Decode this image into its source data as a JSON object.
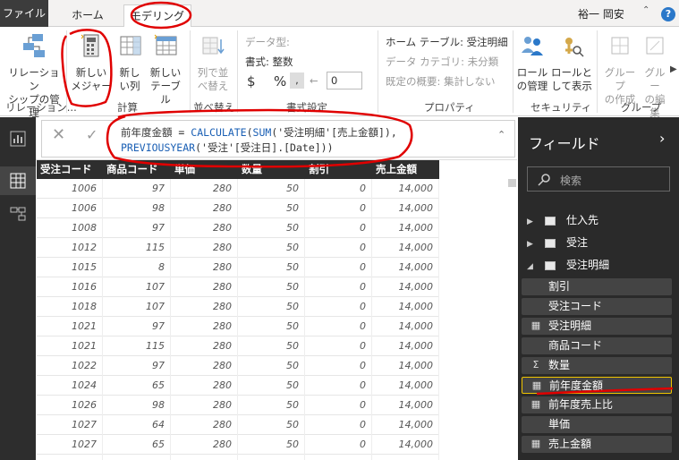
{
  "tabs": {
    "file": "ファイル",
    "home": "ホーム",
    "modeling": "モデリング"
  },
  "user": {
    "name": "裕一 岡安",
    "help": "?"
  },
  "ribbon": {
    "manage_relationships": "リレーション\nシップの管理",
    "new_measure": "新しい\nメジャー",
    "new_column": "新し\nい列",
    "new_table": "新しい\nテーブル",
    "sort_by_column": "列で並\nべ替え",
    "data_type": "データ型:",
    "format": "書式: 整数",
    "currency": "$",
    "percent": "%",
    "comma": ",",
    "decimals": "0",
    "home_table": "ホーム テーブル: 受注明細",
    "data_category": "データ カテゴリ: 未分類",
    "default_summary": "既定の概要: 集計しない",
    "manage_roles": "ロール\nの管理",
    "view_as_roles": "ロールと\nして表示",
    "new_group": "グループ\nの作成",
    "edit_groups": "グルー\nの編集",
    "groups": {
      "relationships": "リレーション...",
      "calculations": "計算",
      "sort": "並べ替え",
      "formatting": "書式設定",
      "properties": "プロパティ",
      "security": "セキュリティ",
      "group": "グループ"
    }
  },
  "formula": {
    "line1_prefix": "前年度金額 = ",
    "line1_fn1": "CALCULATE",
    "line1_paren": "(",
    "line1_fn2": "SUM",
    "line1_rest": "('受注明細'[売上金額]),",
    "line2_fn": "PREVIOUSYEAR",
    "line2_rest": "('受注'[受注日].[Date]))"
  },
  "table": {
    "columns": [
      "受注コード",
      "商品コード",
      "単価",
      "数量",
      "割引",
      "売上金額"
    ],
    "rows": [
      [
        "1006",
        "97",
        "280",
        "50",
        "0",
        "14,000"
      ],
      [
        "1006",
        "98",
        "280",
        "50",
        "0",
        "14,000"
      ],
      [
        "1008",
        "97",
        "280",
        "50",
        "0",
        "14,000"
      ],
      [
        "1012",
        "115",
        "280",
        "50",
        "0",
        "14,000"
      ],
      [
        "1015",
        "8",
        "280",
        "50",
        "0",
        "14,000"
      ],
      [
        "1016",
        "107",
        "280",
        "50",
        "0",
        "14,000"
      ],
      [
        "1018",
        "107",
        "280",
        "50",
        "0",
        "14,000"
      ],
      [
        "1021",
        "97",
        "280",
        "50",
        "0",
        "14,000"
      ],
      [
        "1021",
        "115",
        "280",
        "50",
        "0",
        "14,000"
      ],
      [
        "1022",
        "97",
        "280",
        "50",
        "0",
        "14,000"
      ],
      [
        "1024",
        "65",
        "280",
        "50",
        "0",
        "14,000"
      ],
      [
        "1026",
        "98",
        "280",
        "50",
        "0",
        "14,000"
      ],
      [
        "1027",
        "64",
        "280",
        "50",
        "0",
        "14,000"
      ],
      [
        "1027",
        "65",
        "280",
        "50",
        "0",
        "14,000"
      ],
      [
        "1030",
        "64",
        "280",
        "50",
        "0",
        "14,000"
      ]
    ]
  },
  "fields": {
    "title": "フィールド",
    "search_placeholder": "検索",
    "tables": [
      {
        "name": "仕入先"
      },
      {
        "name": "受注"
      },
      {
        "name": "受注明細"
      }
    ],
    "items": [
      {
        "label": "割引",
        "icon": ""
      },
      {
        "label": "受注コード",
        "icon": ""
      },
      {
        "label": "受注明細",
        "icon": "calc"
      },
      {
        "label": "商品コード",
        "icon": ""
      },
      {
        "label": "数量",
        "icon": "Σ"
      },
      {
        "label": "前年度金額",
        "icon": "calc",
        "selected": true
      },
      {
        "label": "前年度売上比",
        "icon": "calc"
      },
      {
        "label": "単価",
        "icon": ""
      },
      {
        "label": "売上金額",
        "icon": "table"
      }
    ]
  },
  "colors": {
    "annotation": "#e00000",
    "accent": "#f0c400",
    "dark": "#2a2a2a"
  }
}
